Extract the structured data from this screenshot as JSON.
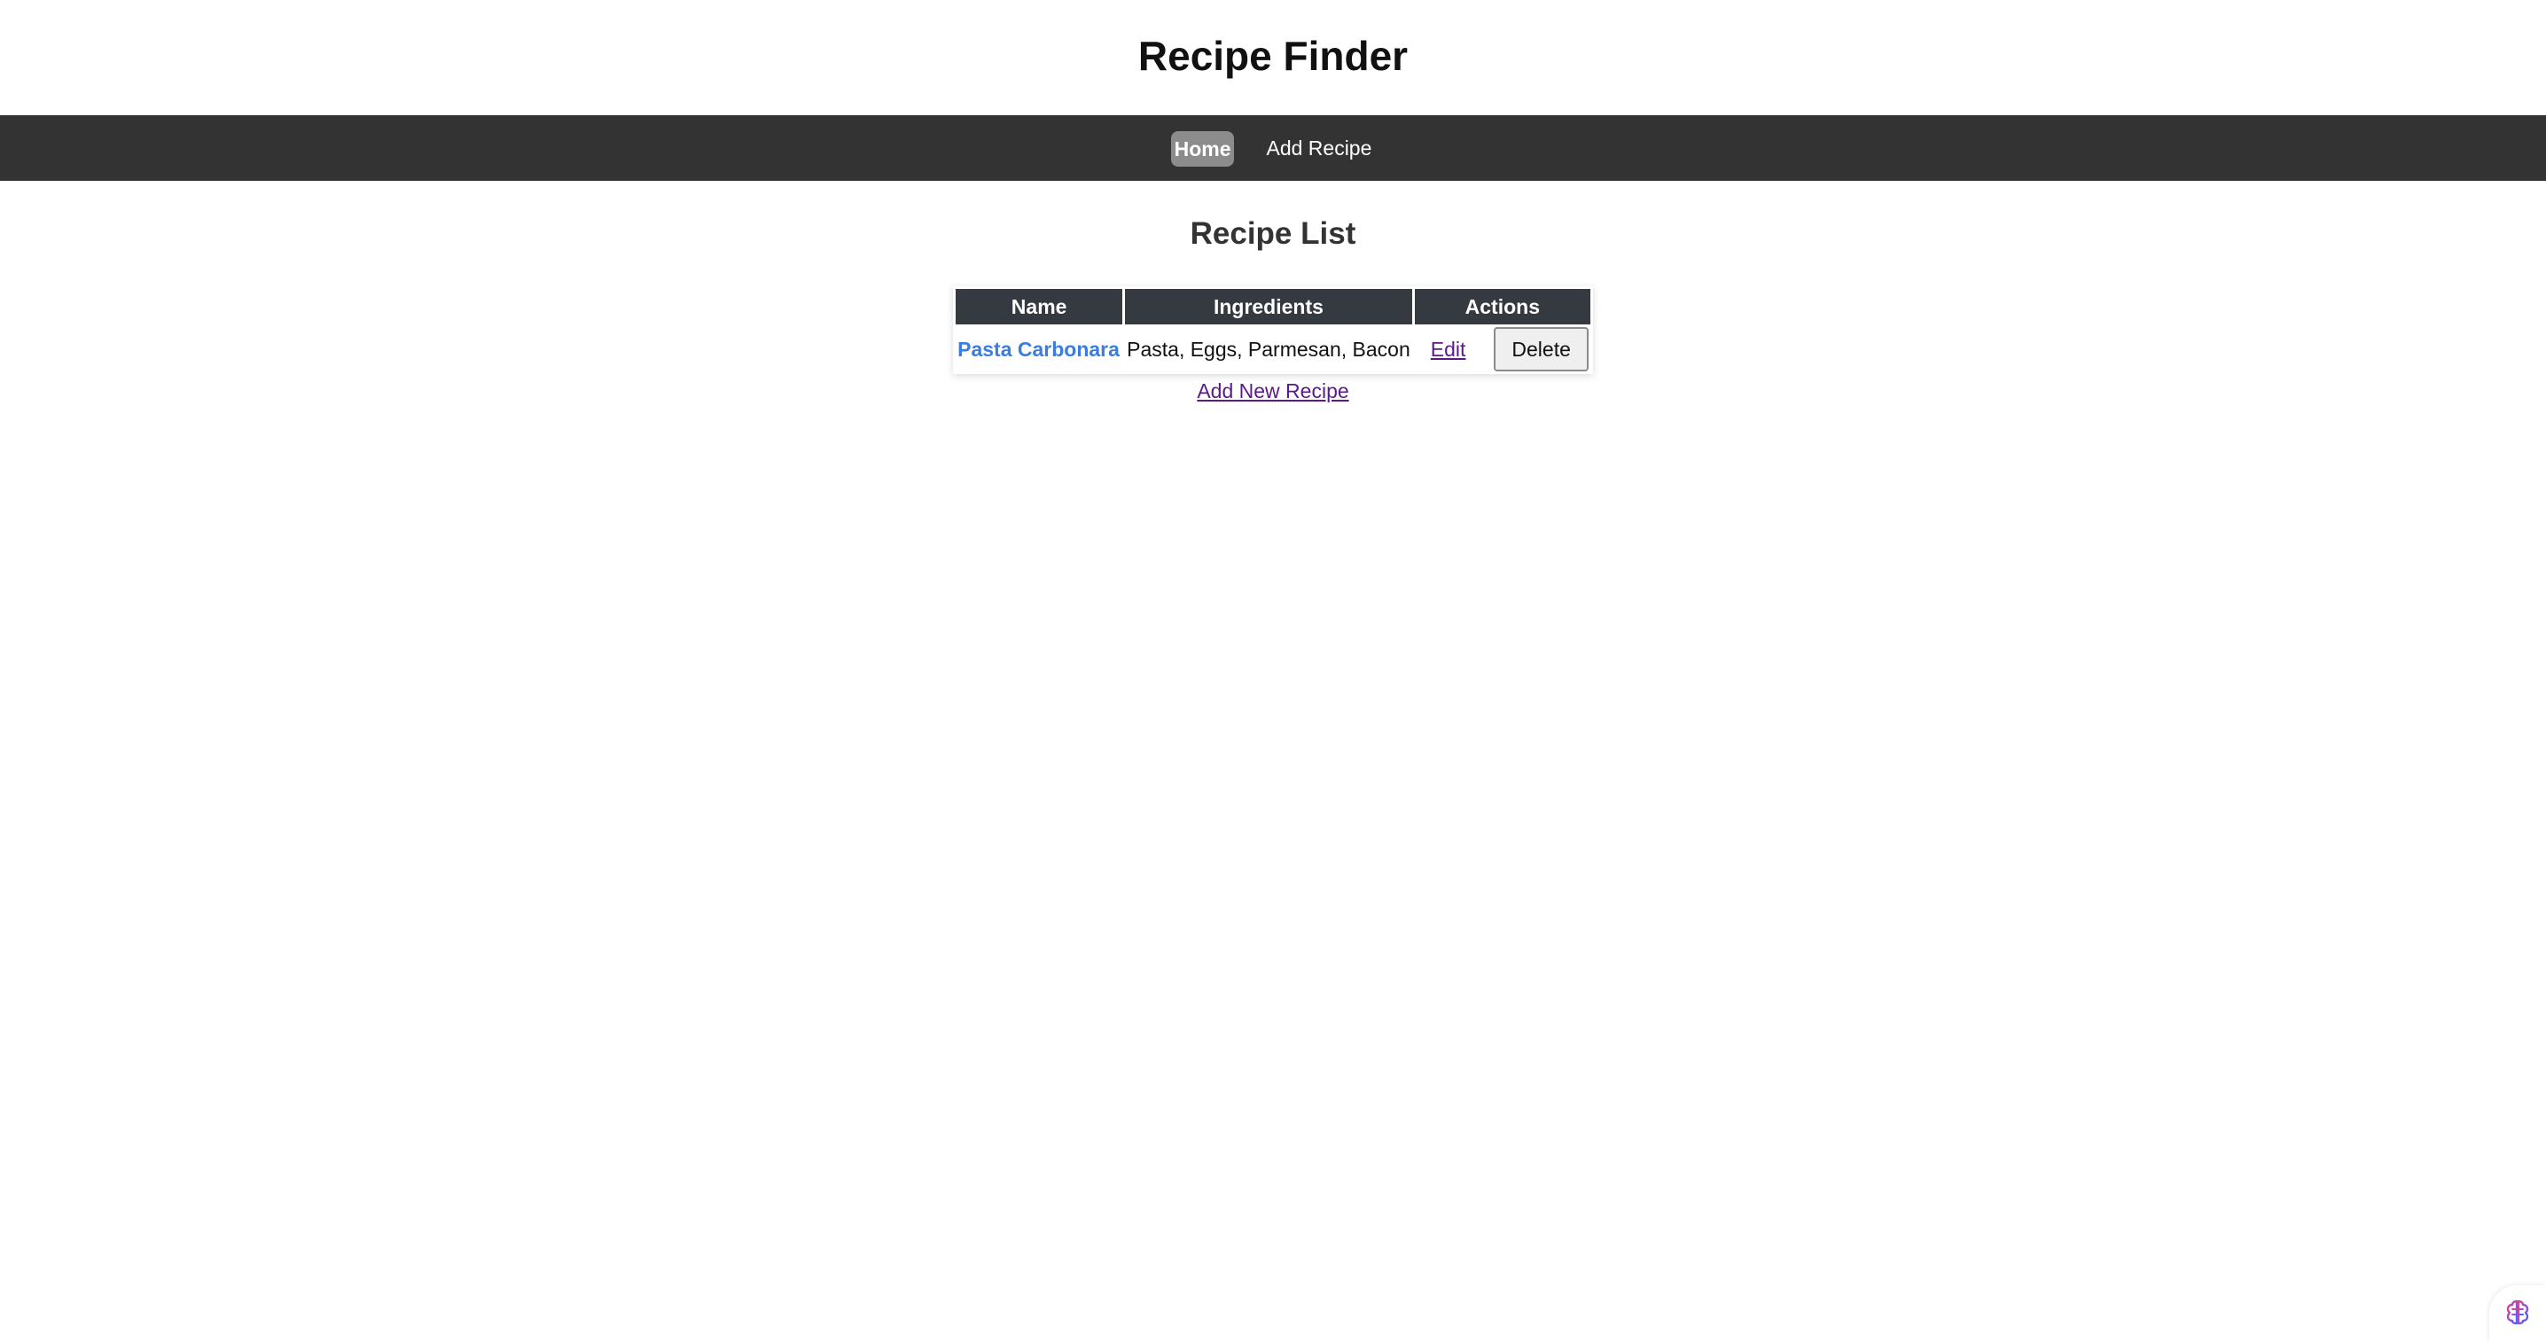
{
  "header": {
    "title": "Recipe Finder"
  },
  "nav": {
    "items": [
      {
        "label": "Home",
        "active": true
      },
      {
        "label": "Add Recipe",
        "active": false
      }
    ]
  },
  "main": {
    "section_title": "Recipe List",
    "table": {
      "columns": [
        "Name",
        "Ingredients",
        "Actions"
      ],
      "rows": [
        {
          "name": "Pasta Carbonara",
          "ingredients": "Pasta, Eggs, Parmesan, Bacon",
          "edit_label": "Edit",
          "delete_label": "Delete"
        }
      ]
    },
    "add_new_link": "Add New Recipe"
  },
  "colors": {
    "navbar_bg": "#333333",
    "nav_active_bg": "#8c8c8c",
    "table_header_bg": "#343a40",
    "recipe_link": "#3b7ddd",
    "visited_link": "#5a1a88"
  },
  "icons": {
    "floating_widget": "brain-icon"
  }
}
